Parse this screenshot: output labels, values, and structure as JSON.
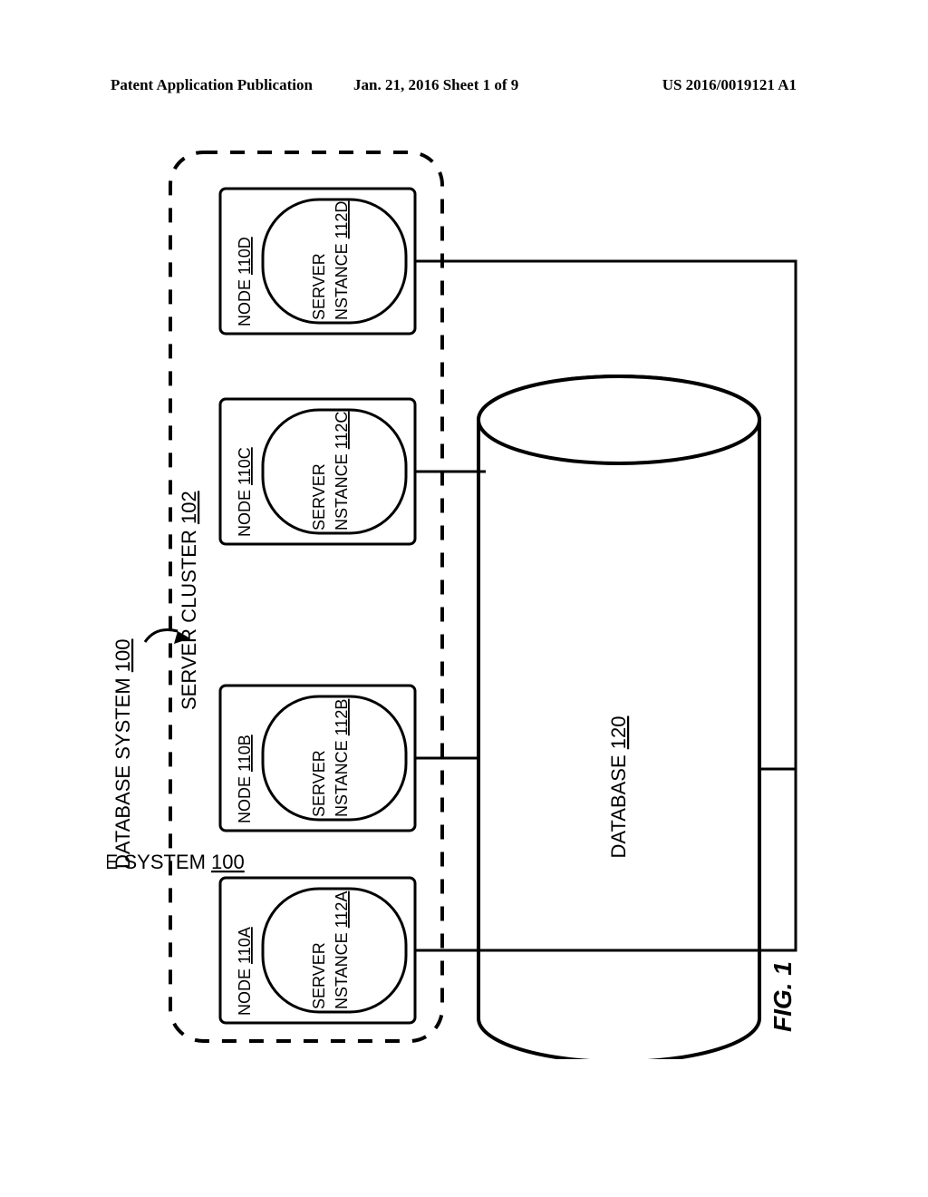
{
  "header": {
    "left": "Patent Application Publication",
    "center": "Jan. 21, 2016  Sheet 1 of 9",
    "right": "US 2016/0019121 A1"
  },
  "figure": {
    "label": "FIG. 1",
    "system_label_prefix": "DATABASE SYSTEM ",
    "system_label_num": "100",
    "cluster_label_prefix": "SERVER CLUSTER ",
    "cluster_label_num": "102",
    "database_label_prefix": "DATABASE ",
    "database_label_num": "120",
    "nodes": [
      {
        "node_label_prefix": "NODE ",
        "node_num": "110A",
        "server_line1": "SERVER",
        "server_line2_prefix": "INSTANCE ",
        "server_num": "112A"
      },
      {
        "node_label_prefix": "NODE ",
        "node_num": "110B",
        "server_line1": "SERVER",
        "server_line2_prefix": "INSTANCE ",
        "server_num": "112B"
      },
      {
        "node_label_prefix": "NODE ",
        "node_num": "110C",
        "server_line1": "SERVER",
        "server_line2_prefix": "INSTANCE ",
        "server_num": "112C"
      },
      {
        "node_label_prefix": "NODE ",
        "node_num": "110D",
        "server_line1": "SERVER",
        "server_line2_prefix": "INSTANCE ",
        "server_num": "112D"
      }
    ]
  }
}
